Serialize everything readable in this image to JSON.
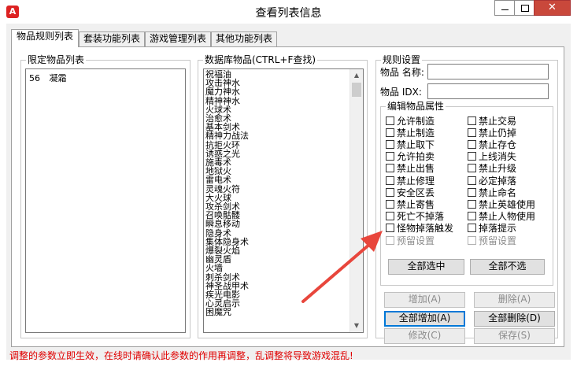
{
  "window": {
    "title": "查看列表信息",
    "app_icon_glyph": "A",
    "close_glyph": "✕"
  },
  "tabs": [
    {
      "label": "物品规则列表",
      "active": true
    },
    {
      "label": "套装功能列表",
      "active": false
    },
    {
      "label": "游戏管理列表",
      "active": false
    },
    {
      "label": "其他功能列表",
      "active": false
    }
  ],
  "restricted": {
    "label": "限定物品列表",
    "items": [
      {
        "id": "56",
        "name": "凝霜"
      }
    ]
  },
  "database": {
    "label": "数据库物品(CTRL+F查找)",
    "items": [
      "祝福油",
      "攻击神水",
      "魔力神水",
      "精神神水",
      "火球术",
      "治愈术",
      "基本剑术",
      "精神力战法",
      "抗拒火环",
      "诱惑之光",
      "施毒术",
      "地狱火",
      "雷电术",
      "灵魂火符",
      "大火球",
      "攻杀剑术",
      "召唤骷髅",
      "瞬息移动",
      "隐身术",
      "集体隐身术",
      "爆裂火焰",
      "幽灵盾",
      "火墙",
      "刺杀剑术",
      "神圣战甲术",
      "疾光电影",
      "心灵启示",
      "困魔咒"
    ]
  },
  "rules": {
    "label": "规则设置",
    "name_label": "物品 名称:",
    "name_value": "",
    "idx_label": "物品 IDX:",
    "idx_value": "",
    "attrs_label": "编辑物品属性",
    "left_checkboxes": [
      {
        "label": "允许制造",
        "checked": false,
        "enabled": true
      },
      {
        "label": "禁止制造",
        "checked": false,
        "enabled": true
      },
      {
        "label": "禁止取下",
        "checked": false,
        "enabled": true
      },
      {
        "label": "允许拍卖",
        "checked": false,
        "enabled": true
      },
      {
        "label": "禁止出售",
        "checked": false,
        "enabled": true
      },
      {
        "label": "禁止修理",
        "checked": false,
        "enabled": true
      },
      {
        "label": "安全区丢",
        "checked": false,
        "enabled": true
      },
      {
        "label": "禁止寄售",
        "checked": false,
        "enabled": true
      },
      {
        "label": "死亡不掉落",
        "checked": false,
        "enabled": true
      },
      {
        "label": "怪物掉落触发",
        "checked": false,
        "enabled": true
      },
      {
        "label": "预留设置",
        "checked": false,
        "enabled": false
      }
    ],
    "right_checkboxes": [
      {
        "label": "禁止交易",
        "checked": false,
        "enabled": true
      },
      {
        "label": "禁止仍掉",
        "checked": false,
        "enabled": true
      },
      {
        "label": "禁止存仓",
        "checked": false,
        "enabled": true
      },
      {
        "label": "上线消失",
        "checked": false,
        "enabled": true
      },
      {
        "label": "禁止升级",
        "checked": false,
        "enabled": true
      },
      {
        "label": "必定掉落",
        "checked": false,
        "enabled": true
      },
      {
        "label": "禁止命名",
        "checked": false,
        "enabled": true
      },
      {
        "label": "禁止英雄使用",
        "checked": false,
        "enabled": true
      },
      {
        "label": "禁止人物使用",
        "checked": false,
        "enabled": true
      },
      {
        "label": "掉落提示",
        "checked": false,
        "enabled": true
      },
      {
        "label": "预留设置",
        "checked": false,
        "enabled": false
      }
    ],
    "select_all": "全部选中",
    "deselect_all": "全部不选"
  },
  "actions": {
    "add": "增加(A)",
    "delete": "删除(A)",
    "add_all": "全部增加(A)",
    "delete_all": "全部删除(D)",
    "modify": "修改(C)",
    "save": "保存(S)"
  },
  "status_text": "调整的参数立即生效，在线时请确认此参数的作用再调整，乱调整将导致游戏混乱!",
  "colors": {
    "close_button": "#c9483b",
    "status_text": "#e00000",
    "annotation_arrow": "#e8463c"
  }
}
